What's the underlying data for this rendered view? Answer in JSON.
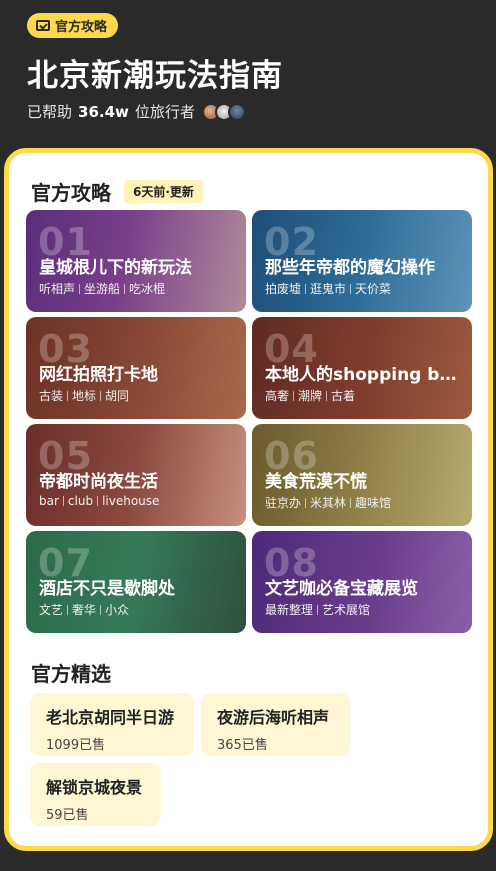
{
  "header": {
    "badge_label": "官方攻略",
    "title": "北京新潮玩法指南",
    "helped_prefix": "已帮助",
    "helped_count": "36.4w",
    "helped_suffix": "位旅行者"
  },
  "guides": {
    "section_title": "官方攻略",
    "update_tag": "6天前·更新",
    "tiles": [
      {
        "num": "01",
        "name": "皇城根儿下的新玩法",
        "tags": [
          "听相声",
          "坐游船",
          "吃冰棍"
        ]
      },
      {
        "num": "02",
        "name": "那些年帝都的魔幻操作",
        "tags": [
          "拍废墟",
          "逛鬼市",
          "天价菜"
        ]
      },
      {
        "num": "03",
        "name": "网红拍照打卡地",
        "tags": [
          "古装",
          "地标",
          "胡同"
        ]
      },
      {
        "num": "04",
        "name": "本地人的shopping bo...",
        "tags": [
          "高奢",
          "潮牌",
          "古着"
        ]
      },
      {
        "num": "05",
        "name": "帝都时尚夜生活",
        "tags": [
          "bar",
          "club",
          "livehouse"
        ]
      },
      {
        "num": "06",
        "name": "美食荒漠不慌",
        "tags": [
          "驻京办",
          "米其林",
          "趣味馆"
        ]
      },
      {
        "num": "07",
        "name": "酒店不只是歇脚处",
        "tags": [
          "文艺",
          "奢华",
          "小众"
        ]
      },
      {
        "num": "08",
        "name": "文艺咖必备宝藏展览",
        "tags": [
          "最新整理",
          "艺术展馆"
        ]
      }
    ]
  },
  "picks": {
    "section_title": "官方精选",
    "items": [
      {
        "name": "老北京胡同半日游",
        "sold": "1099已售"
      },
      {
        "name": "夜游后海听相声",
        "sold": "365已售"
      },
      {
        "name": "解锁京城夜景",
        "sold": "59已售"
      }
    ]
  },
  "colors": {
    "accent": "#ffd84d",
    "header_bg": "#2a2a2a",
    "pick_bg": "#fff6d3"
  }
}
